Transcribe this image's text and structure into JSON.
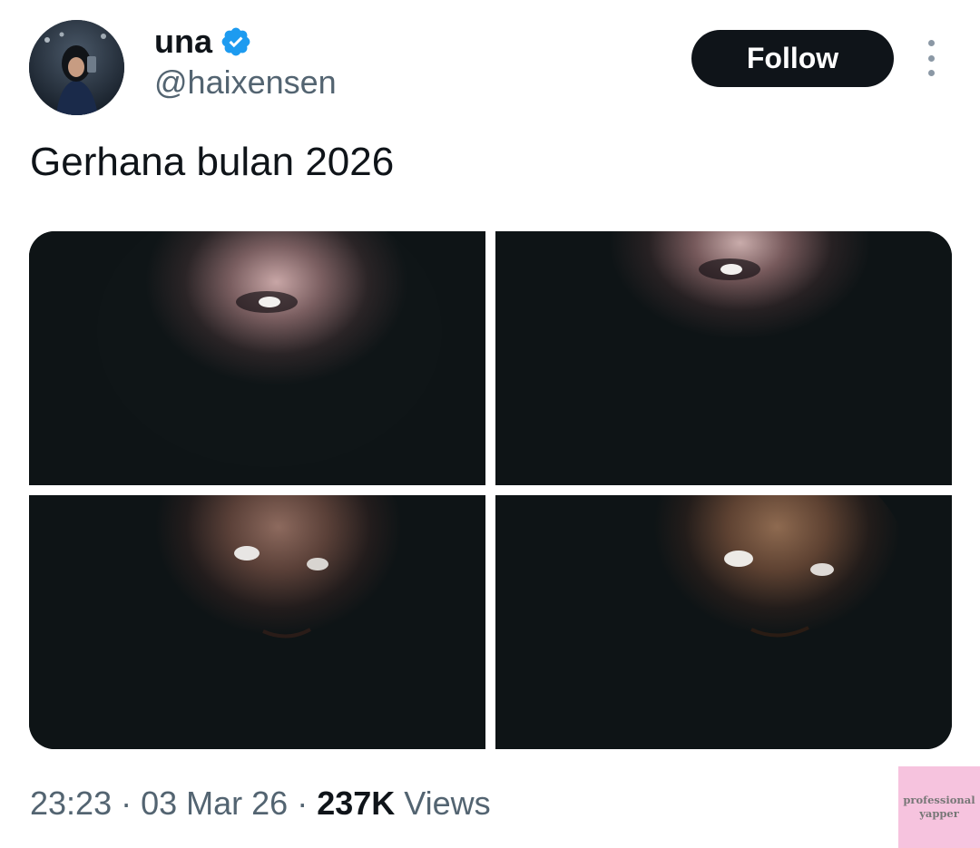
{
  "author": {
    "display_name": "una",
    "handle": "@haixensen",
    "verified": true,
    "avatar_icon": "profile-photo"
  },
  "actions": {
    "follow_label": "Follow",
    "more_icon": "more-vertical-icon"
  },
  "tweet": {
    "text": "Gerhana bulan 2026",
    "media": [
      {
        "description": "dark blurry face photo 1"
      },
      {
        "description": "dark blurry face photo 2"
      },
      {
        "description": "dark blurry face photo 3"
      },
      {
        "description": "dark blurry face photo 4"
      }
    ]
  },
  "meta": {
    "time": "23:23",
    "separator": "·",
    "date": "03 Mar 26",
    "views_count": "237K",
    "views_label": "Views"
  },
  "watermark": {
    "line1": "professional",
    "line2": "yapper"
  },
  "colors": {
    "follow_bg": "#0f1419",
    "verified_blue": "#1d9bf0",
    "secondary_text": "#536471",
    "watermark_bg": "#f6c3de"
  }
}
